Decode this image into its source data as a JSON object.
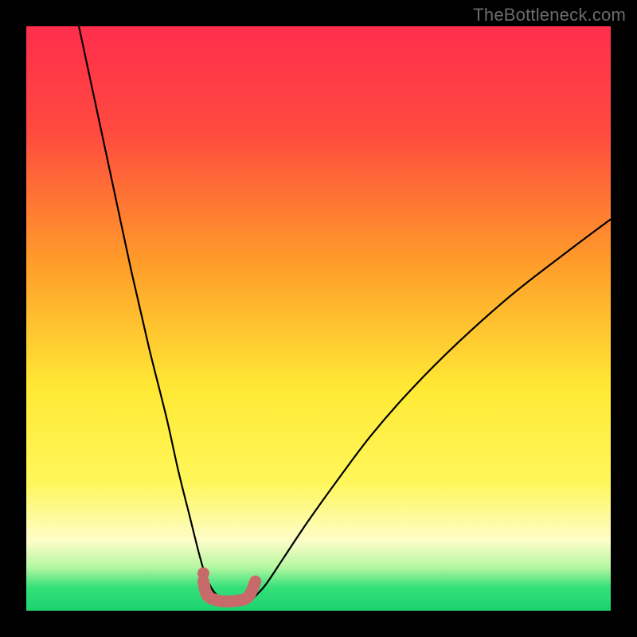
{
  "watermark": "TheBottleneck.com",
  "colors": {
    "gradient_top": "#ff2e4d",
    "gradient_mid_red": "#ff4a3f",
    "gradient_orange": "#ff9b2a",
    "gradient_yellow": "#ffe935",
    "gradient_yellow2": "#fff75a",
    "gradient_cream": "#fdfdc9",
    "gradient_lightgreen": "#b7f7a1",
    "gradient_green": "#35e07a",
    "gradient_green2": "#1bd36f",
    "curve_stroke": "#000000",
    "marker_stroke": "#c96a6a",
    "marker_fill": "#c96a6a",
    "frame": "#000000"
  },
  "chart_data": {
    "type": "line",
    "title": "",
    "xlabel": "",
    "ylabel": "",
    "xlim": [
      0,
      100
    ],
    "ylim": [
      0,
      100
    ],
    "grid": false,
    "series": [
      {
        "name": "left-curve",
        "x": [
          9,
          12,
          15,
          18,
          21,
          24,
          26,
          28,
          29.5,
          30.5,
          31.5,
          32.5,
          33.5
        ],
        "values": [
          100,
          86,
          72,
          58,
          45,
          33,
          24,
          16,
          10,
          6.5,
          4.2,
          2.8,
          2.3
        ]
      },
      {
        "name": "right-curve",
        "x": [
          39,
          41,
          44,
          48,
          53,
          59,
          66,
          74,
          83,
          92,
          100
        ],
        "values": [
          2.3,
          4.5,
          9,
          15,
          22,
          30,
          38,
          46,
          54,
          61,
          67
        ]
      }
    ],
    "markers": {
      "name": "bottleneck-zone",
      "type": "u-marker",
      "color": "#c96a6a",
      "left_dot": {
        "x": 30.3,
        "y": 6.4
      },
      "u_path": [
        {
          "x": 30.3,
          "y": 5.0
        },
        {
          "x": 31.0,
          "y": 2.6
        },
        {
          "x": 33.0,
          "y": 1.7
        },
        {
          "x": 36.0,
          "y": 1.7
        },
        {
          "x": 38.0,
          "y": 2.4
        },
        {
          "x": 39.2,
          "y": 5.0
        }
      ]
    }
  }
}
